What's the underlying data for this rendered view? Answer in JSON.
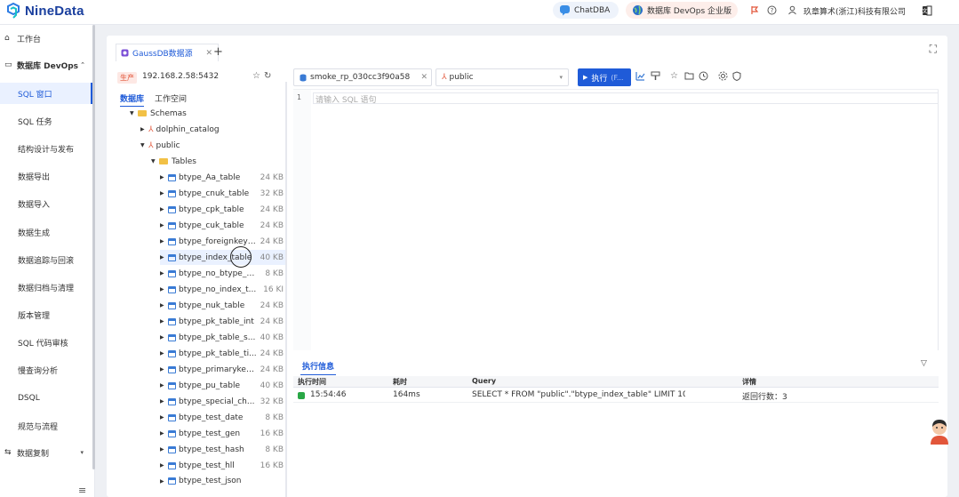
{
  "header": {
    "logo_text": "NineData",
    "chatdba": "ChatDBA",
    "devops": "数据库 DevOps 企业版",
    "company": "玖章算术(浙江)科技有限公司"
  },
  "sidebar": {
    "items": [
      {
        "label": "工作台"
      },
      {
        "label": "数据库 DevOps"
      },
      {
        "label": "SQL 窗口"
      },
      {
        "label": "SQL 任务"
      },
      {
        "label": "结构设计与发布"
      },
      {
        "label": "数据导出"
      },
      {
        "label": "数据导入"
      },
      {
        "label": "数据生成"
      },
      {
        "label": "数据追踪与回滚"
      },
      {
        "label": "数据归档与清理"
      },
      {
        "label": "版本管理"
      },
      {
        "label": "SQL 代码审核"
      },
      {
        "label": "慢查询分析"
      },
      {
        "label": "DSQL"
      },
      {
        "label": "规范与流程"
      },
      {
        "label": "数据复制"
      }
    ]
  },
  "tab": {
    "label": "GaussDB数据源"
  },
  "datasource": {
    "env": "生产",
    "host": "192.168.2.58:5432"
  },
  "tree": {
    "tabs": [
      "数据库",
      "工作空间"
    ],
    "schemas_label": "Schemas",
    "schema_1": "dolphin_catalog",
    "schema_2": "public",
    "tables_label": "Tables",
    "tables": [
      {
        "name": "btype_Aa_table",
        "size": "24 KB"
      },
      {
        "name": "btype_cnuk_table",
        "size": "32 KB"
      },
      {
        "name": "btype_cpk_table",
        "size": "24 KB"
      },
      {
        "name": "btype_cuk_table",
        "size": "24 KB"
      },
      {
        "name": "btype_foreignkeyt...",
        "size": "24 KB"
      },
      {
        "name": "btype_index_table",
        "size": "40 KB"
      },
      {
        "name": "btype_no_btype_p...",
        "size": "8 KB"
      },
      {
        "name": "btype_no_index_t...",
        "size": "16 KI"
      },
      {
        "name": "btype_nuk_table",
        "size": "24 KB"
      },
      {
        "name": "btype_pk_table_int",
        "size": "24 KB"
      },
      {
        "name": "btype_pk_table_s...",
        "size": "40 KB"
      },
      {
        "name": "btype_pk_table_ti...",
        "size": "24 KB"
      },
      {
        "name": "btype_primarykey...",
        "size": "24 KB"
      },
      {
        "name": "btype_pu_table",
        "size": "40 KB"
      },
      {
        "name": "btype_special_ch...",
        "size": "32 KB"
      },
      {
        "name": "btype_test_date",
        "size": "8 KB"
      },
      {
        "name": "btype_test_gen",
        "size": "16 KB"
      },
      {
        "name": "btype_test_hash",
        "size": "8 KB"
      },
      {
        "name": "btype_test_hll",
        "size": "16 KB"
      },
      {
        "name": "btype_test_json",
        "size": ""
      }
    ]
  },
  "toolbar": {
    "database": "smoke_rp_030cc3f90a58",
    "schema": "public",
    "run_label": "执行",
    "run_sub": "(F..."
  },
  "editor": {
    "line_number": "1",
    "placeholder": "请输入 SQL 语句"
  },
  "result": {
    "tab_label": "执行信息",
    "columns": [
      "执行时间",
      "耗时",
      "Query",
      "详情"
    ],
    "rows": [
      {
        "time": "15:54:46",
        "duration": "164ms",
        "query": "SELECT * FROM \"public\".\"btype_index_table\" LIMIT 100;",
        "detail": "返回行数：3"
      }
    ]
  }
}
